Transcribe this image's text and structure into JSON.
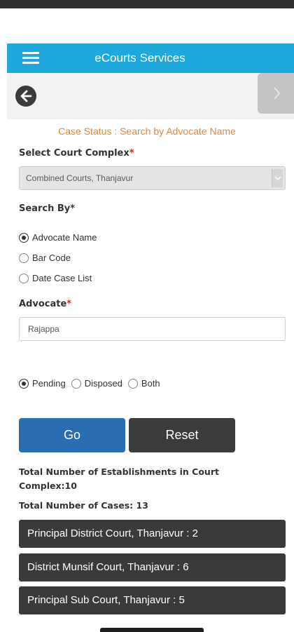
{
  "app": {
    "title": "eCourts Services"
  },
  "page": {
    "heading": "Case Status : Search by Advocate Name"
  },
  "court_complex": {
    "label": "Select Court Complex",
    "required_mark": "*",
    "selected": "Combined Courts, Thanjavur"
  },
  "search_by": {
    "label": "Search By",
    "required_mark": "*",
    "options": [
      "Advocate Name",
      "Bar Code",
      "Date Case List"
    ],
    "selected": "Advocate Name"
  },
  "advocate": {
    "label": "Advocate",
    "required_mark": "*",
    "value": "Rajappa"
  },
  "case_status_filter": {
    "options": [
      "Pending",
      "Disposed",
      "Both"
    ],
    "selected": "Pending"
  },
  "buttons": {
    "go": "Go",
    "reset": "Reset"
  },
  "results": {
    "establishments_line1": "Total Number of Establishments in Court",
    "establishments_line2": "Complex:10",
    "total_cases": "Total Number of Cases: 13",
    "establishments": [
      "Principal District Court, Thanjavur : 2",
      "District Munsif Court, Thanjavur : 6",
      "Principal Sub Court, Thanjavur : 5"
    ]
  },
  "colors": {
    "appbar": "#1ea8dc",
    "heading": "#e0893a",
    "required": "#d9232e",
    "go_button": "#2a6db0",
    "reset_button": "#3b3b3b",
    "list_item": "#3a3a3a"
  },
  "icons": {
    "menu": "hamburger-menu-icon",
    "back": "arrow-left-icon",
    "forward": "chevron-right-icon",
    "dropdown": "chevron-down-icon"
  }
}
